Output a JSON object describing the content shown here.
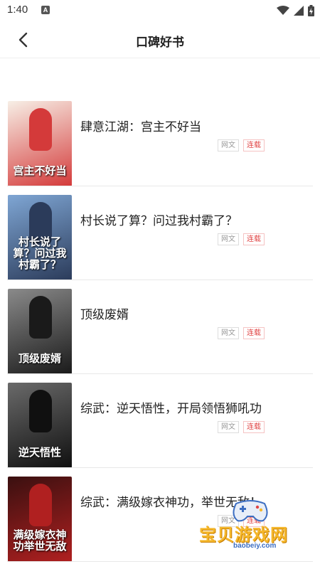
{
  "status": {
    "time": "1:40",
    "notice": "A"
  },
  "header": {
    "title": "口碑好书"
  },
  "books": [
    {
      "title": "肆意江湖：宫主不好当",
      "tag_genre": "网文",
      "tag_status": "连载",
      "cover_title": "宫主不好当",
      "cover_author": "",
      "cover_colors": [
        "#f7efe6",
        "#d43a3a"
      ]
    },
    {
      "title": "村长说了算？问过我村霸了？",
      "tag_genre": "网文",
      "tag_status": "连载",
      "cover_title": "村长说了算？问过我村霸了？",
      "cover_author": "",
      "cover_colors": [
        "#7fa6d4",
        "#2b3b5a"
      ]
    },
    {
      "title": "顶级废婿",
      "tag_genre": "网文",
      "tag_status": "连载",
      "cover_title": "顶级废婿",
      "cover_author": "",
      "cover_colors": [
        "#8a8a8a",
        "#1a1a1a"
      ]
    },
    {
      "title": "综武：逆天悟性，开局领悟狮吼功",
      "tag_genre": "网文",
      "tag_status": "连载",
      "cover_title": "逆天悟性",
      "cover_author": "",
      "cover_colors": [
        "#6a6a6a",
        "#101010"
      ]
    },
    {
      "title": "综武：满级嫁衣神功，举世无敌！",
      "tag_genre": "网文",
      "tag_status": "连载",
      "cover_title": "满级嫁衣神功举世无敌",
      "cover_author": "",
      "cover_colors": [
        "#3a1010",
        "#b02020"
      ]
    }
  ],
  "watermark": {
    "text": "宝贝游戏网",
    "url": "baobeiy.com"
  },
  "colors": {
    "tag_red": "#e04444",
    "tag_gray": "#999999"
  }
}
